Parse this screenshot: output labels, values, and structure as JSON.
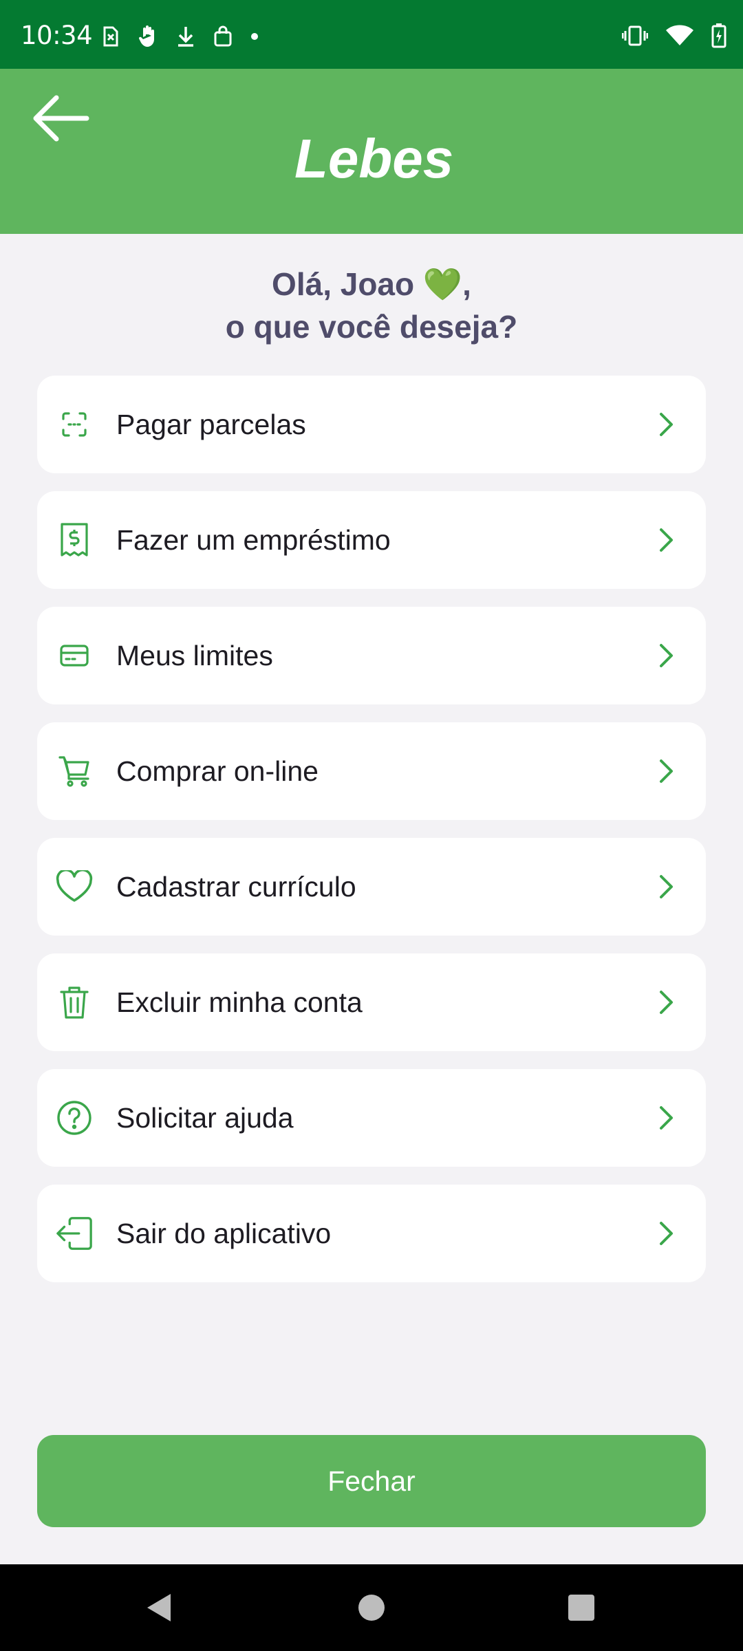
{
  "status_bar": {
    "time": "10:34",
    "left_icons": [
      "sim-off-icon",
      "hand-icon",
      "download-icon",
      "shopping-bag-icon",
      "dot-icon"
    ],
    "right_icons": [
      "vibrate-icon",
      "wifi-icon",
      "battery-charging-icon"
    ]
  },
  "header": {
    "logo_text": "Lebes",
    "back_icon": "arrow-left-icon"
  },
  "greeting": {
    "line1": "Olá, Joao 💚,",
    "line2": "o que você deseja?"
  },
  "menu": {
    "items": [
      {
        "label": "Pagar parcelas",
        "icon": "barcode-scan-icon"
      },
      {
        "label": "Fazer um empréstimo",
        "icon": "receipt-dollar-icon"
      },
      {
        "label": "Meus limites",
        "icon": "credit-card-icon"
      },
      {
        "label": "Comprar on-line",
        "icon": "cart-icon"
      },
      {
        "label": "Cadastrar currículo",
        "icon": "heart-icon"
      },
      {
        "label": "Excluir minha conta",
        "icon": "trash-icon"
      },
      {
        "label": "Solicitar ajuda",
        "icon": "help-circle-icon"
      },
      {
        "label": "Sair do aplicativo",
        "icon": "logout-icon"
      }
    ]
  },
  "close_button": {
    "label": "Fechar"
  },
  "colors": {
    "status_bar": "#047a31",
    "header": "#5fb55e",
    "accent": "#3aa64a",
    "background": "#f3f2f5",
    "greeting_text": "#4f4c6a"
  }
}
